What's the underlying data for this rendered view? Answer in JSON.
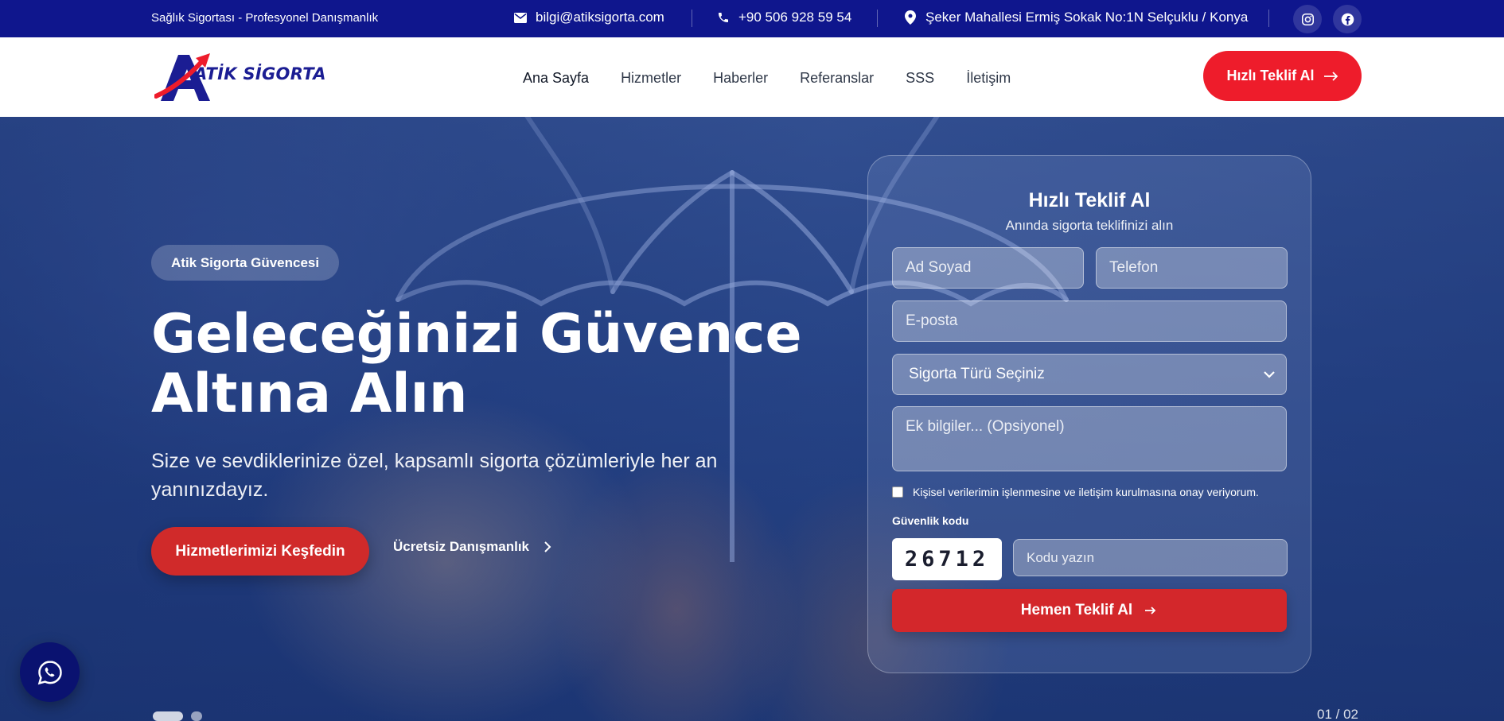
{
  "topbar": {
    "tagline": "Sağlık Sigortası - Profesyonel Danışmanlık",
    "email": "bilgi@atiksigorta.com",
    "phone": "+90 506 928 59 54",
    "address": "Şeker Mahallesi Ermiş Sokak No:1N Selçuklu / Konya",
    "social": [
      "instagram-icon",
      "facebook-icon"
    ]
  },
  "header": {
    "logo_text": "ATİK SİGORTA",
    "nav": [
      "Ana Sayfa",
      "Hizmetler",
      "Haberler",
      "Referanslar",
      "SSS",
      "İletişim"
    ],
    "cta_label": "Hızlı Teklif Al"
  },
  "hero": {
    "badge": "Atik Sigorta Güvencesi",
    "title_line1": "Geleceğinizi Güvence",
    "title_line2": "Altına Alın",
    "subtitle": "Size ve sevdiklerinize özel, kapsamlı sigorta çözümleriyle her an yanınızdayız.",
    "primary_button": "Hizmetlerimizi Keşfedin",
    "secondary_button": "Ücretsiz Danışmanlık",
    "slide_counter": "01 / 02"
  },
  "form": {
    "title": "Hızlı Teklif Al",
    "subtitle": "Anında sigorta teklifinizi alın",
    "name_placeholder": "Ad Soyad",
    "phone_placeholder": "Telefon",
    "email_placeholder": "E-posta",
    "insurance_type_selected": "Sigorta Türü Seçiniz",
    "notes_placeholder": "Ek bilgiler... (Opsiyonel)",
    "consent_label": "Kişisel verilerimin işlenmesine ve iletişim kurulmasına onay veriyorum.",
    "captcha_label": "Güvenlik kodu",
    "captcha_code": "26712",
    "captcha_placeholder": "Kodu yazın",
    "submit_label": "Hemen Teklif Al"
  },
  "colors": {
    "topbar_bg": "#0f168d",
    "brand_red": "#ee1c2b",
    "brand_blue": "#1b1d93",
    "button_red": "#d3272b"
  }
}
